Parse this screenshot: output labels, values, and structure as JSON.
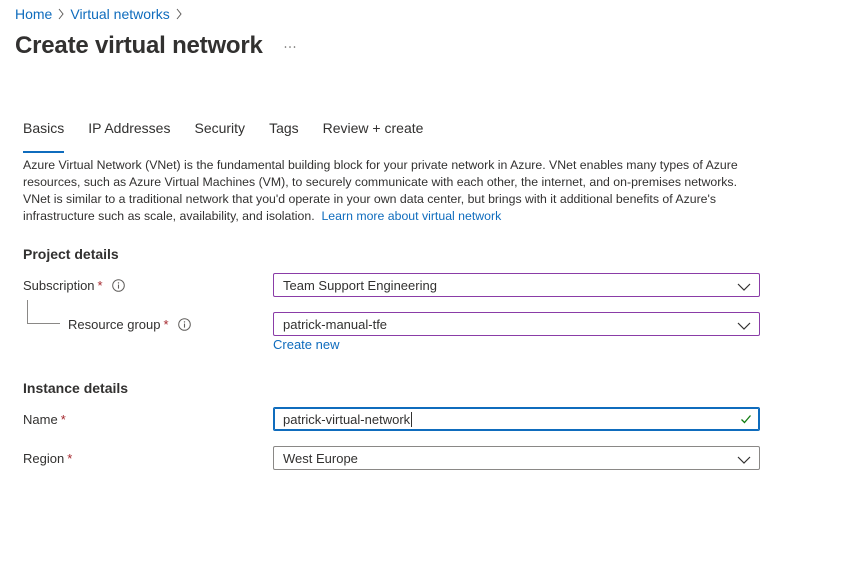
{
  "breadcrumb": {
    "items": [
      {
        "label": "Home"
      },
      {
        "label": "Virtual networks"
      }
    ]
  },
  "page": {
    "title": "Create virtual network",
    "more_label": "..."
  },
  "tabs": [
    {
      "label": "Basics",
      "active": true
    },
    {
      "label": "IP Addresses",
      "active": false
    },
    {
      "label": "Security",
      "active": false
    },
    {
      "label": "Tags",
      "active": false
    },
    {
      "label": "Review + create",
      "active": false
    }
  ],
  "intro": {
    "text": "Azure Virtual Network (VNet) is the fundamental building block for your private network in Azure. VNet enables many types of Azure resources, such as Azure Virtual Machines (VM), to securely communicate with each other, the internet, and on-premises networks. VNet is similar to a traditional network that you'd operate in your own data center, but brings with it additional benefits of Azure's infrastructure such as scale, availability, and isolation.",
    "link": "Learn more about virtual network"
  },
  "project_details": {
    "title": "Project details",
    "subscription": {
      "label": "Subscription",
      "required": "*",
      "value": "Team Support Engineering"
    },
    "resource_group": {
      "label": "Resource group",
      "required": "*",
      "value": "patrick-manual-tfe",
      "create_new": "Create new"
    }
  },
  "instance_details": {
    "title": "Instance details",
    "name": {
      "label": "Name",
      "required": "*",
      "value": "patrick-virtual-network"
    },
    "region": {
      "label": "Region",
      "required": "*",
      "value": "West Europe"
    }
  },
  "colors": {
    "link": "#0f6cbd",
    "required": "#a4262c",
    "focus_purple": "#8a3ca7",
    "valid_green": "#107c10"
  },
  "icons": {
    "breadcrumb_separator": "chevron-right-icon",
    "info": "info-icon",
    "dropdown": "chevron-down-icon",
    "valid": "checkmark-icon"
  }
}
